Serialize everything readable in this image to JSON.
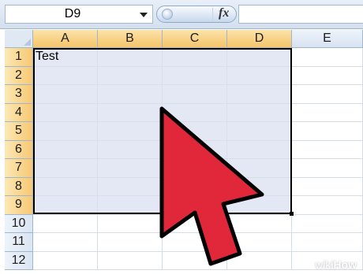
{
  "name_box": {
    "value": "D9"
  },
  "formula_bar": {
    "fx_label": "fx",
    "content": ""
  },
  "columns": [
    "A",
    "B",
    "C",
    "D",
    "E"
  ],
  "rows": [
    "1",
    "2",
    "3",
    "4",
    "5",
    "6",
    "7",
    "8",
    "9",
    "10",
    "11",
    "12"
  ],
  "cells": {
    "A1": "Test"
  },
  "selection": {
    "range": "A1:D9"
  },
  "colors": {
    "selection_fill": "#e3e8f4",
    "header_highlight": "#f5c46a",
    "cursor_fill": "#e0283a",
    "cursor_outline": "#000000"
  },
  "watermark": {
    "prefix": "wiki",
    "suffix": "How"
  }
}
